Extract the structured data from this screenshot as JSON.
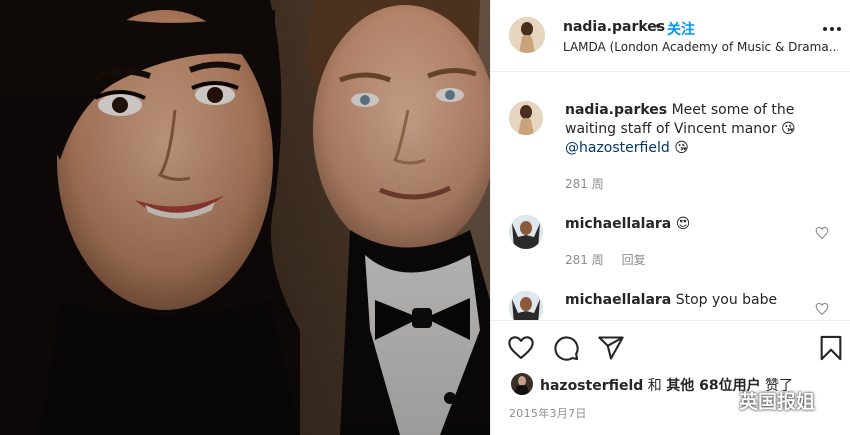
{
  "post": {
    "username": "nadia.parkes",
    "follow_label": "关注",
    "separator": "•",
    "location": "LAMDA (London Academy of Music & Drama..."
  },
  "caption": {
    "author": "nadia.parkes",
    "text": "Meet some of the waiting staff of Vincent manor",
    "emoji": "😘",
    "mention": "@hazosterfield",
    "mention_emoji": "😘",
    "time": "281 周"
  },
  "comments": [
    {
      "author": "michaellalara",
      "text": "",
      "emoji": "😍",
      "time": "281 周",
      "reply_label": "回复"
    },
    {
      "author": "michaellalara",
      "text": "Stop you babe"
    }
  ],
  "likes": {
    "liker": "hazosterfield",
    "connector": "和",
    "others": "其他 68",
    "suffix": "位用户",
    "verb": "赞了"
  },
  "date": "2015年3月7日",
  "watermark": {
    "text": "英国报姐"
  },
  "icons": {
    "more": "more-options-icon",
    "like": "heart-icon",
    "comment": "comment-icon",
    "share": "share-icon",
    "save": "bookmark-icon"
  },
  "colors": {
    "link": "#0095f6",
    "mention": "#00376b",
    "muted": "#8e8e8e",
    "text": "#262626"
  }
}
